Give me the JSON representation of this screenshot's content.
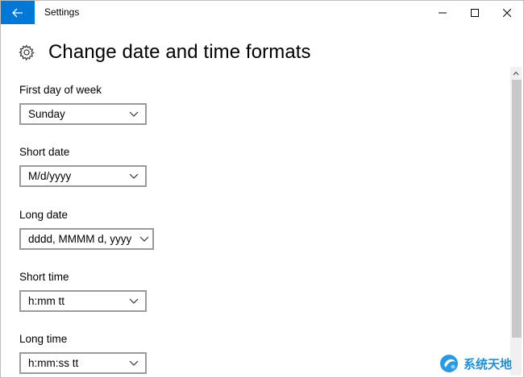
{
  "window": {
    "title": "Settings"
  },
  "page": {
    "title": "Change date and time formats"
  },
  "settings": [
    {
      "label": "First day of week",
      "value": "Sunday"
    },
    {
      "label": "Short date",
      "value": "M/d/yyyy"
    },
    {
      "label": "Long date",
      "value": "dddd, MMMM d, yyyy"
    },
    {
      "label": "Short time",
      "value": "h:mm tt"
    },
    {
      "label": "Long time",
      "value": "h:mm:ss tt"
    }
  ],
  "icons": {
    "back": "arrow-left-icon",
    "page": "gear-icon",
    "dropdown": "chevron-down-icon",
    "minimize": "minimize-icon",
    "maximize": "maximize-icon",
    "close": "close-icon"
  },
  "colors": {
    "accent": "#0078d7",
    "dropdown_border": "#9a9a9a"
  },
  "watermark": {
    "text": "系统天地"
  }
}
